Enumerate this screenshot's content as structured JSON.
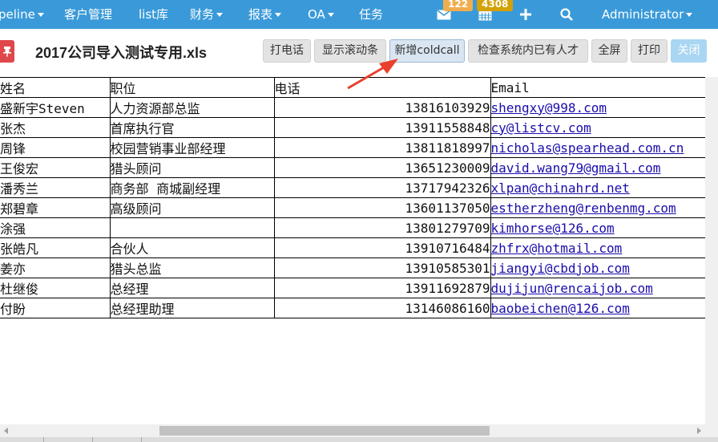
{
  "nav": {
    "items": [
      {
        "label": "peline",
        "caret": true
      },
      {
        "label": "客户管理",
        "caret": false
      },
      {
        "label": "list库",
        "caret": false
      },
      {
        "label": "财务",
        "caret": true
      },
      {
        "label": "报表",
        "caret": true
      },
      {
        "label": "OA",
        "caret": true
      },
      {
        "label": "任务",
        "caret": false
      }
    ],
    "mail_badge": "122",
    "calendar_badge": "4308",
    "user": "Administrator",
    "color": "#3a9ad9"
  },
  "file": {
    "title": "2017公司导入测试专用.xls"
  },
  "toolbar": {
    "call": "打电话",
    "show_scrollbar": "显示滚动条",
    "add_coldcall": "新增coldcall",
    "check_talent": "检查系统内已有人才",
    "fullscreen": "全屏",
    "print": "打印",
    "close": "关闭"
  },
  "table": {
    "headers": [
      "姓名",
      "职位",
      "电话",
      "Email"
    ],
    "rows": [
      {
        "name": "盛新宇Steven",
        "position": "人力资源部总监",
        "phone": "13816103929",
        "email": "shengxy@998.com"
      },
      {
        "name": "张杰",
        "position": "首席执行官",
        "phone": "13911558848",
        "email": "cy@listcv.com"
      },
      {
        "name": "周锋",
        "position": "校园营销事业部经理",
        "phone": "13811818997",
        "email": "nicholas@spearhead.com.cn"
      },
      {
        "name": "王俊宏",
        "position": "猎头顾问",
        "phone": "13651230009",
        "email": "david.wang79@gmail.com"
      },
      {
        "name": "潘秀兰",
        "position": "商务部 商城副经理",
        "phone": "13717942326",
        "email": "xlpan@chinahrd.net"
      },
      {
        "name": "郑碧章",
        "position": "高级顾问",
        "phone": "13601137050",
        "email": "estherzheng@renbenmg.com"
      },
      {
        "name": "涂强",
        "position": "",
        "phone": "13801279709",
        "email": "kimhorse@126.com"
      },
      {
        "name": "张皓凡",
        "position": "合伙人",
        "phone": "13910716484",
        "email": "zhfrx@hotmail.com"
      },
      {
        "name": "姜亦",
        "position": "猎头总监",
        "phone": "13910585301",
        "email": "jiangyi@cbdjob.com"
      },
      {
        "name": "杜继俊",
        "position": "总经理",
        "phone": "13911692879",
        "email": "dujijun@rencaijob.com"
      },
      {
        "name": "付盼",
        "position": "总经理助理",
        "phone": "13146086160",
        "email": "baobeichen@126.com"
      }
    ]
  }
}
